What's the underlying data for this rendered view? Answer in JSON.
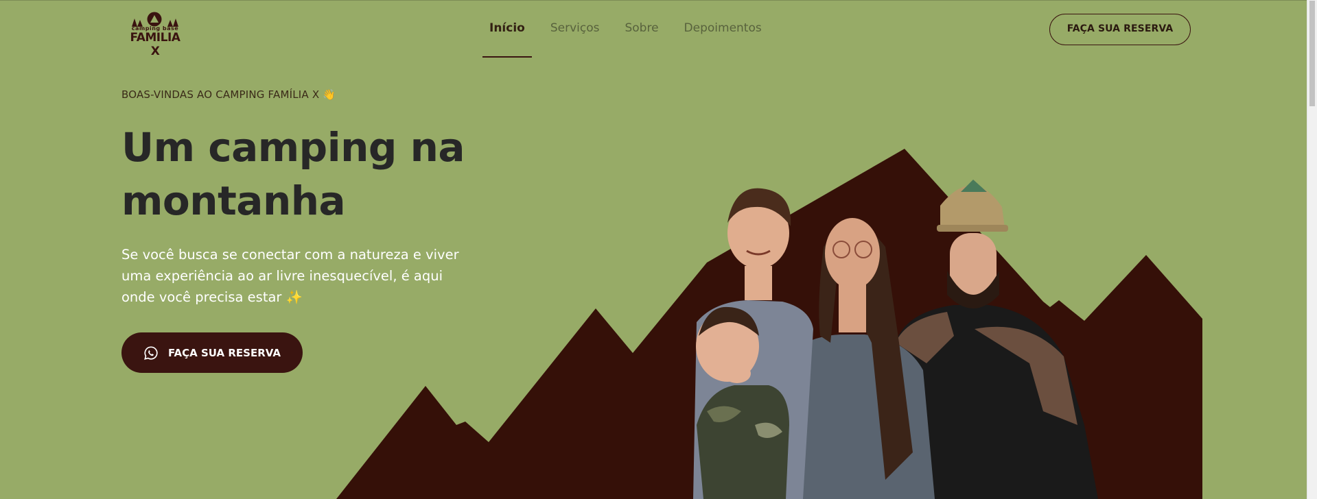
{
  "logo": {
    "tagline": "camping base",
    "name": "FAMILIA X"
  },
  "nav": {
    "items": [
      {
        "label": "Início",
        "active": true
      },
      {
        "label": "Serviços",
        "active": false
      },
      {
        "label": "Sobre",
        "active": false
      },
      {
        "label": "Depoimentos",
        "active": false
      }
    ]
  },
  "header": {
    "cta_label": "FAÇA SUA RESERVA"
  },
  "hero": {
    "eyebrow": "BOAS-VINDAS AO CAMPING FAMÍLIA X 👋",
    "title": "Um camping na montanha",
    "description": "Se você busca se conectar com a natureza e viver uma experiência ao ar livre inesquecível, é aqui onde você precisa estar ✨",
    "cta_label": "FAÇA SUA RESERVA",
    "cta_icon": "whatsapp-icon"
  },
  "colors": {
    "background": "#97ab67",
    "brand_dark": "#3a1410",
    "heading": "#272727",
    "text_light": "#ffffff"
  }
}
